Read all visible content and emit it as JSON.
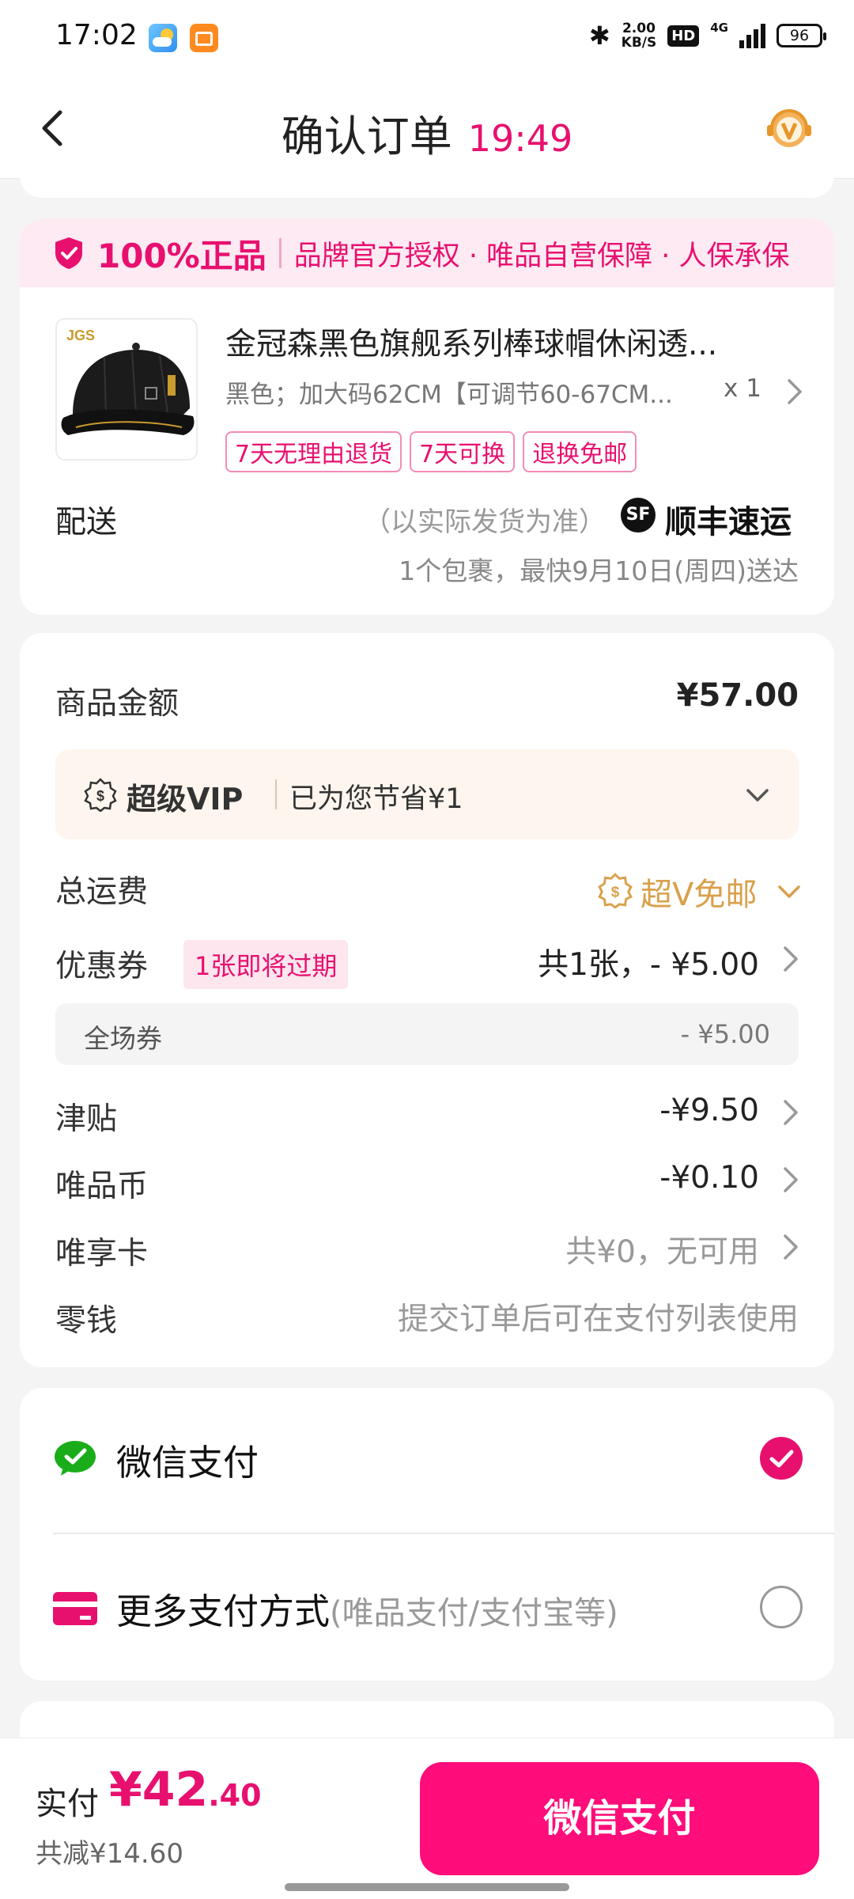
{
  "status_bar": {
    "time": "17:02",
    "net_speed": "2.00",
    "net_unit": "KB/S",
    "hd": "HD",
    "net_type": "4G",
    "battery": "96"
  },
  "header": {
    "title": "确认订单",
    "countdown": "19:49"
  },
  "guarantee": {
    "title": "100%正品",
    "desc": "品牌官方授权 · 唯品自营保障 · 人保承保"
  },
  "product": {
    "name": "金冠森黑色旗舰系列棒球帽休闲透...",
    "spec": "黑色；加大码62CM【可调节60-67CM...",
    "qty": "x 1",
    "tags": [
      "7天无理由退货",
      "7天可换",
      "退换免邮"
    ]
  },
  "shipping": {
    "label": "配送",
    "note": "（以实际发货为准）",
    "carrier_logo": "SF",
    "carrier": "顺丰速运",
    "eta": "1个包裹，最快9月10日(周四)送达"
  },
  "price": {
    "goods_label": "商品金额",
    "goods_amount": "¥57.00",
    "vip_title": "超级VIP",
    "vip_save": "已为您节省¥1",
    "freight_label": "总运费",
    "freight_value": "超V免邮",
    "coupon_label": "优惠券",
    "coupon_tag": "1张即将过期",
    "coupon_value": "共1张，- ¥5.00",
    "coupon_sub_label": "全场券",
    "coupon_sub_value": "- ¥5.00",
    "subsidy_label": "津贴",
    "subsidy_value": "-¥9.50",
    "coin_label": "唯品币",
    "coin_value": "-¥0.10",
    "card_label": "唯享卡",
    "card_value": "共¥0，无可用",
    "change_label": "零钱",
    "change_value": "提交订单后可在支付列表使用"
  },
  "payment": {
    "wechat_label": "微信支付",
    "wechat_selected": true,
    "more_label": "更多支付方式",
    "more_sub": "(唯品支付/支付宝等)",
    "more_selected": false
  },
  "bottom": {
    "paid_label": "实付",
    "amount_int": "¥42",
    "amount_dec": ".40",
    "saved": "共减¥14.60",
    "pay_button": "微信支付"
  },
  "colors": {
    "accent": "#e8106f",
    "button": "#ff0d7a",
    "gold": "#d9a04b"
  }
}
